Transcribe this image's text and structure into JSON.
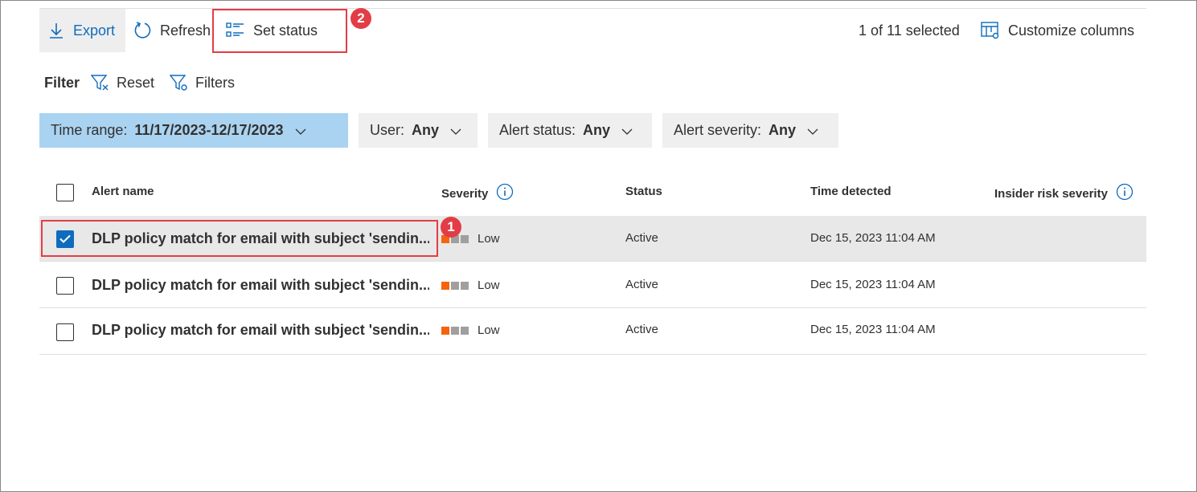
{
  "toolbar": {
    "export_label": "Export",
    "refresh_label": "Refresh",
    "set_status_label": "Set status",
    "selected_text": "1 of 11 selected",
    "customize_label": "Customize columns"
  },
  "filter": {
    "label": "Filter",
    "reset_label": "Reset",
    "filters_label": "Filters",
    "pills": [
      {
        "name": "Time range:",
        "value": "11/17/2023-12/17/2023"
      },
      {
        "name": "User:",
        "value": "Any"
      },
      {
        "name": "Alert status:",
        "value": "Any"
      },
      {
        "name": "Alert severity:",
        "value": "Any"
      }
    ]
  },
  "table": {
    "headers": {
      "alert_name": "Alert name",
      "severity": "Severity",
      "status": "Status",
      "time_detected": "Time detected",
      "insider_risk": "Insider risk severity"
    },
    "rows": [
      {
        "checked": true,
        "alert_name": "DLP policy match for email with subject 'sendin...",
        "severity": "Low",
        "status": "Active",
        "time_detected": "Dec 15, 2023 11:04 AM",
        "insider_risk": ""
      },
      {
        "checked": false,
        "alert_name": "DLP policy match for email with subject 'sendin...",
        "severity": "Low",
        "status": "Active",
        "time_detected": "Dec 15, 2023 11:04 AM",
        "insider_risk": ""
      },
      {
        "checked": false,
        "alert_name": "DLP policy match for email with subject 'sendin...",
        "severity": "Low",
        "status": "Active",
        "time_detected": "Dec 15, 2023 11:04 AM",
        "insider_risk": ""
      }
    ]
  },
  "callouts": {
    "one": "1",
    "two": "2"
  },
  "colors": {
    "accent": "#0f6cbd",
    "severity_low": "#f7630c",
    "severity_inactive": "#a19f9d",
    "callout": "#e23d46",
    "active_pill": "#aad3f1"
  }
}
